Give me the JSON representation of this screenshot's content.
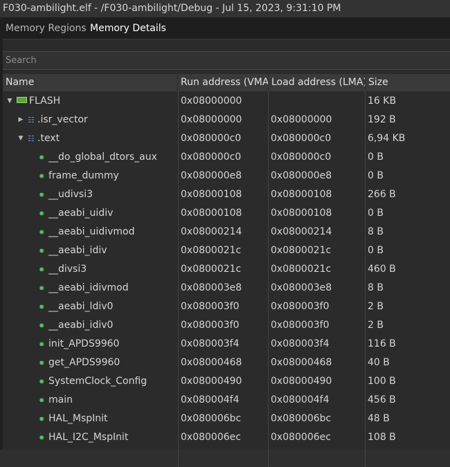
{
  "window": {
    "title": "F030-ambilight.elf - /F030-ambilight/Debug - Jul 15, 2023, 9:31:10 PM"
  },
  "tabs": [
    {
      "label": "Memory Regions"
    },
    {
      "label": "Memory Details"
    }
  ],
  "search": {
    "placeholder": "Search"
  },
  "columns": [
    "Name",
    "Run address (VMA)",
    "Load address (LMA)",
    "Size"
  ],
  "rows": [
    {
      "name": "FLASH",
      "vma": "0x08000000",
      "lma": "",
      "size": "16 KB",
      "level": 0,
      "toggle": "expanded",
      "icon": "memory-chip-icon"
    },
    {
      "name": ".isr_vector",
      "vma": "0x08000000",
      "lma": "0x08000000",
      "size": "192 B",
      "level": 1,
      "toggle": "collapsed",
      "icon": "section-icon"
    },
    {
      "name": ".text",
      "vma": "0x080000c0",
      "lma": "0x080000c0",
      "size": "6,94 KB",
      "level": 1,
      "toggle": "expanded",
      "icon": "section-icon"
    },
    {
      "name": "__do_global_dtors_aux",
      "vma": "0x080000c0",
      "lma": "0x080000c0",
      "size": "0 B",
      "level": 2,
      "toggle": "none",
      "icon": "symbol-icon"
    },
    {
      "name": "frame_dummy",
      "vma": "0x080000e8",
      "lma": "0x080000e8",
      "size": "0 B",
      "level": 2,
      "toggle": "none",
      "icon": "symbol-icon"
    },
    {
      "name": "__udivsi3",
      "vma": "0x08000108",
      "lma": "0x08000108",
      "size": "266 B",
      "level": 2,
      "toggle": "none",
      "icon": "symbol-icon"
    },
    {
      "name": "__aeabi_uidiv",
      "vma": "0x08000108",
      "lma": "0x08000108",
      "size": "0 B",
      "level": 2,
      "toggle": "none",
      "icon": "symbol-icon"
    },
    {
      "name": "__aeabi_uidivmod",
      "vma": "0x08000214",
      "lma": "0x08000214",
      "size": "8 B",
      "level": 2,
      "toggle": "none",
      "icon": "symbol-icon"
    },
    {
      "name": "__aeabi_idiv",
      "vma": "0x0800021c",
      "lma": "0x0800021c",
      "size": "0 B",
      "level": 2,
      "toggle": "none",
      "icon": "symbol-icon"
    },
    {
      "name": "__divsi3",
      "vma": "0x0800021c",
      "lma": "0x0800021c",
      "size": "460 B",
      "level": 2,
      "toggle": "none",
      "icon": "symbol-icon"
    },
    {
      "name": "__aeabi_idivmod",
      "vma": "0x080003e8",
      "lma": "0x080003e8",
      "size": "8 B",
      "level": 2,
      "toggle": "none",
      "icon": "symbol-icon"
    },
    {
      "name": "__aeabi_ldiv0",
      "vma": "0x080003f0",
      "lma": "0x080003f0",
      "size": "2 B",
      "level": 2,
      "toggle": "none",
      "icon": "symbol-icon"
    },
    {
      "name": "__aeabi_idiv0",
      "vma": "0x080003f0",
      "lma": "0x080003f0",
      "size": "2 B",
      "level": 2,
      "toggle": "none",
      "icon": "symbol-icon"
    },
    {
      "name": "init_APDS9960",
      "vma": "0x080003f4",
      "lma": "0x080003f4",
      "size": "116 B",
      "level": 2,
      "toggle": "none",
      "icon": "symbol-icon"
    },
    {
      "name": "get_APDS9960",
      "vma": "0x08000468",
      "lma": "0x08000468",
      "size": "40 B",
      "level": 2,
      "toggle": "none",
      "icon": "symbol-icon"
    },
    {
      "name": "SystemClock_Config",
      "vma": "0x08000490",
      "lma": "0x08000490",
      "size": "100 B",
      "level": 2,
      "toggle": "none",
      "icon": "symbol-icon"
    },
    {
      "name": "main",
      "vma": "0x080004f4",
      "lma": "0x080004f4",
      "size": "456 B",
      "level": 2,
      "toggle": "none",
      "icon": "symbol-icon"
    },
    {
      "name": "HAL_MspInit",
      "vma": "0x080006bc",
      "lma": "0x080006bc",
      "size": "48 B",
      "level": 2,
      "toggle": "none",
      "icon": "symbol-icon"
    },
    {
      "name": "HAL_I2C_MspInit",
      "vma": "0x080006ec",
      "lma": "0x080006ec",
      "size": "108 B",
      "level": 2,
      "toggle": "none",
      "icon": "symbol-icon"
    }
  ]
}
